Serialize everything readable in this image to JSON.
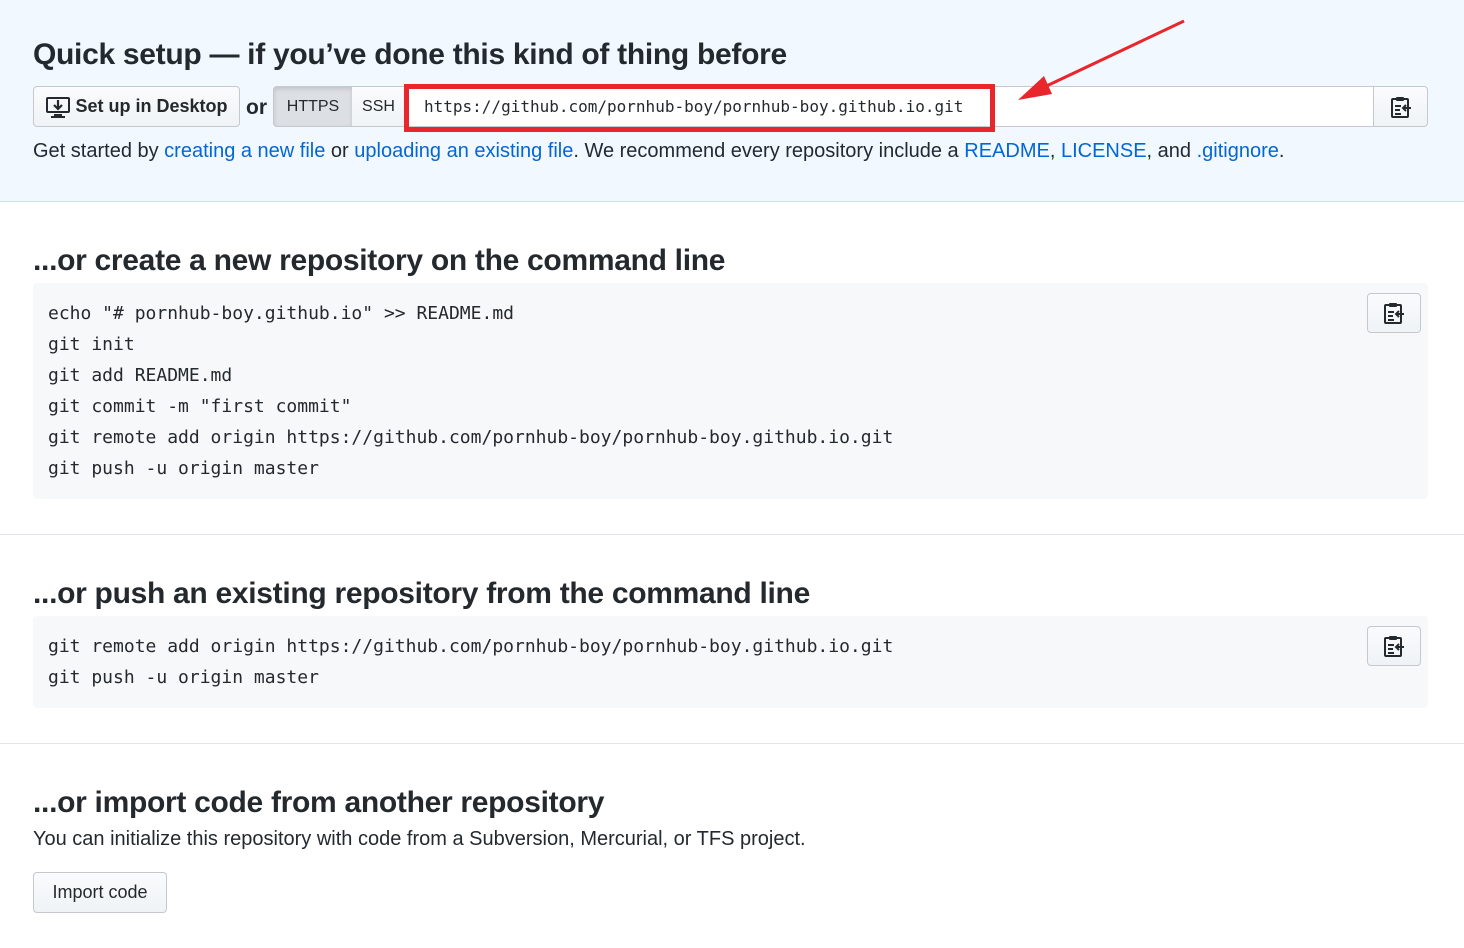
{
  "quick_setup": {
    "title": "Quick setup — if you’ve done this kind of thing before",
    "desktop_button_label": "Set up in Desktop",
    "or_label": "or",
    "https_label": "HTTPS",
    "ssh_label": "SSH",
    "clone_url": "https://github.com/pornhub-boy/pornhub-boy.github.io.git",
    "intro_prefix": "Get started by ",
    "link_create_file": "creating a new file",
    "intro_or": " or ",
    "link_upload_file": "uploading an existing file",
    "intro_middle": ". We recommend every repository include a ",
    "link_readme": "README",
    "comma": ",",
    "link_license": "LICENSE",
    "intro_and": ", and ",
    "link_gitignore": ".gitignore",
    "period": "."
  },
  "create_section": {
    "title": "...or create a new repository on the command line",
    "lines": [
      "echo \"# pornhub-boy.github.io\" >> README.md",
      "git init",
      "git add README.md",
      "git commit -m \"first commit\"",
      "git remote add origin https://github.com/pornhub-boy/pornhub-boy.github.io.git",
      "git push -u origin master"
    ]
  },
  "push_section": {
    "title": "...or push an existing repository from the command line",
    "lines": [
      "git remote add origin https://github.com/pornhub-boy/pornhub-boy.github.io.git",
      "git push -u origin master"
    ]
  },
  "import_section": {
    "title": "...or import code from another repository",
    "description": "You can initialize this repository with code from a Subversion, Mercurial, or TFS project.",
    "button_label": "Import code"
  },
  "icons": {
    "desktop": "desktop-download-icon",
    "clipboard": "clippy-icon"
  },
  "colors": {
    "link": "#0366d6",
    "quick_setup_bg": "#f1f8ff",
    "highlight_annotation": "#e8262b"
  }
}
